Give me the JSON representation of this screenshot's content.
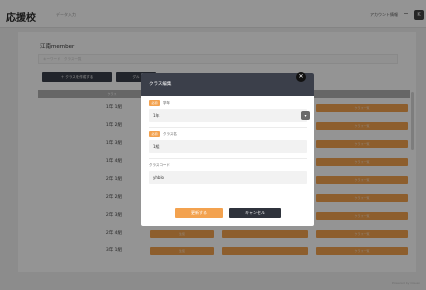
{
  "header": {
    "logo": "応援校",
    "logo_sub": "データ入力",
    "account_label": "アカウント情報",
    "account_badge": "K"
  },
  "page": {
    "group_title": "江南member",
    "search_placeholder": "キーワード　クラス一覧",
    "create_button": "＋ クラスを作成する",
    "sub_button": "グル",
    "table_header": "クラス"
  },
  "rows": [
    {
      "label": "1年 1組",
      "cells": [
        "",
        "",
        "クラス一覧"
      ]
    },
    {
      "label": "1年 2組",
      "cells": [
        "",
        "",
        "クラス一覧"
      ]
    },
    {
      "label": "1年 3組",
      "cells": [
        "",
        "",
        "クラス一覧"
      ]
    },
    {
      "label": "1年 4組",
      "cells": [
        "",
        "",
        "クラス一覧"
      ]
    },
    {
      "label": "2年 1組",
      "cells": [
        "",
        "",
        "クラス一覧"
      ]
    },
    {
      "label": "2年 2組",
      "cells": [
        "",
        "",
        "クラス一覧"
      ]
    },
    {
      "label": "2年 3組",
      "cells": [
        "",
        "",
        "クラス一覧"
      ]
    },
    {
      "label": "2年 4組",
      "cells": [
        "生徒",
        "",
        "クラス一覧"
      ]
    },
    {
      "label": "3年 1組",
      "cells": [
        "生徒",
        "",
        "クラス一覧"
      ]
    }
  ],
  "modal": {
    "title": "クラス編集",
    "required_tag": "必須",
    "grade_label": "学年",
    "grade_value": "1年",
    "class_label": "クラス名",
    "class_value": "1組",
    "code_label": "クラスコード",
    "code_value": "yhblo",
    "save_button": "更新する",
    "cancel_button": "キャンセル",
    "close_symbol": "✕"
  },
  "footer": "Powered by Oouen",
  "colors": {
    "accent_orange": "#f3a24f",
    "dark_header": "#3b3f4a"
  }
}
